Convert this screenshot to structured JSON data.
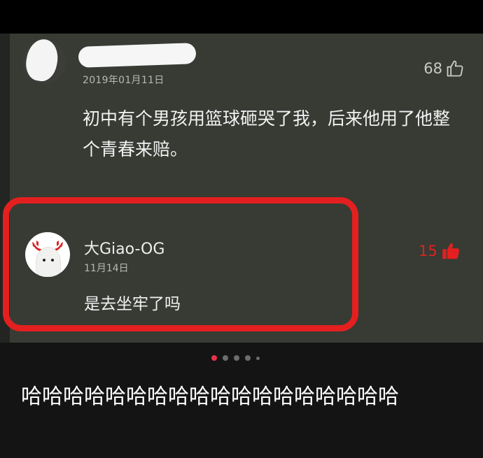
{
  "comment1": {
    "date": "2019年01月11日",
    "likes": "68",
    "text": "初中有个男孩用篮球砸哭了我，后来他用了他整个青春来赔。"
  },
  "reply": {
    "author": "大Giao-OG",
    "date": "11月14日",
    "text": "是去坐牢了吗",
    "likes": "15"
  },
  "pager": {
    "total_dots": 5,
    "active_index": 0
  },
  "caption": {
    "text": "哈哈哈哈哈哈哈哈哈哈哈哈哈哈哈哈哈哈"
  },
  "colors": {
    "highlight": "#e3201f",
    "screen_bg": "#373b34",
    "liked": "#e3201f"
  }
}
